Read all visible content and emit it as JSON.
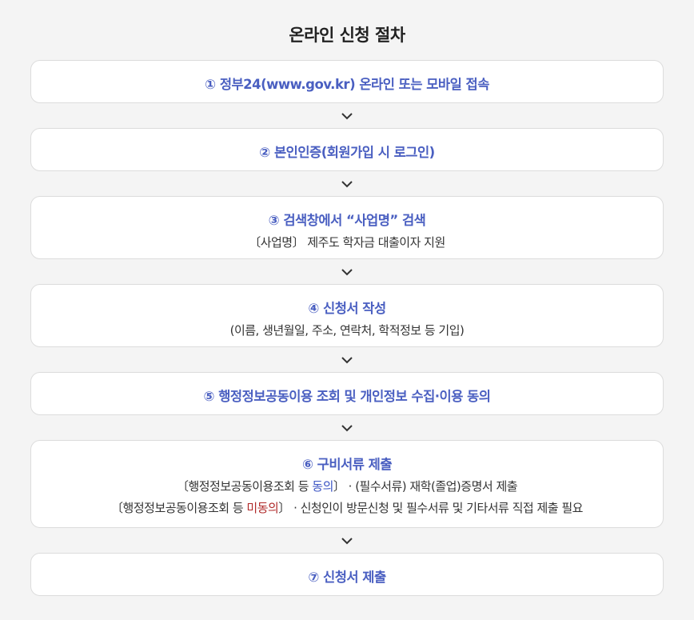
{
  "title": "온라인 신청 절차",
  "steps": [
    {
      "title": "① 정부24(www.gov.kr) 온라인 또는 모바일 접속"
    },
    {
      "title": "② 본인인증(회원가입 시 로그인)"
    },
    {
      "title": "③ 검색창에서 “사업명” 검색",
      "desc": "〔사업명〕 제주도 학자금 대출이자 지원"
    },
    {
      "title": "④ 신청서 작성",
      "desc": "(이름, 생년월일, 주소, 연락처, 학적정보 등 기입)"
    },
    {
      "title": "⑤ 행정정보공동이용 조회 및 개인정보 수집·이용 동의"
    },
    {
      "title": "⑥ 구비서류 제출",
      "lines": [
        {
          "pre": "〔행정정보공동이용조회 등 ",
          "hl": "동의",
          "post": "〕 · (필수서류) 재학(졸업)증명서 제출"
        },
        {
          "pre": "〔행정정보공동이용조회 등 ",
          "hl": "미동의",
          "post": "〕 · 신청인이 방문신청 및 필수서류 및 기타서류 직접 제출 필요"
        }
      ]
    },
    {
      "title": "⑦ 신청서 제출"
    }
  ],
  "colors": {
    "step_title": "#4a5fc1",
    "agree": "#3d56c4",
    "disagree": "#b02a2a",
    "background": "#f4f4f4"
  },
  "icons": {
    "arrow": "chevron-down-icon"
  }
}
